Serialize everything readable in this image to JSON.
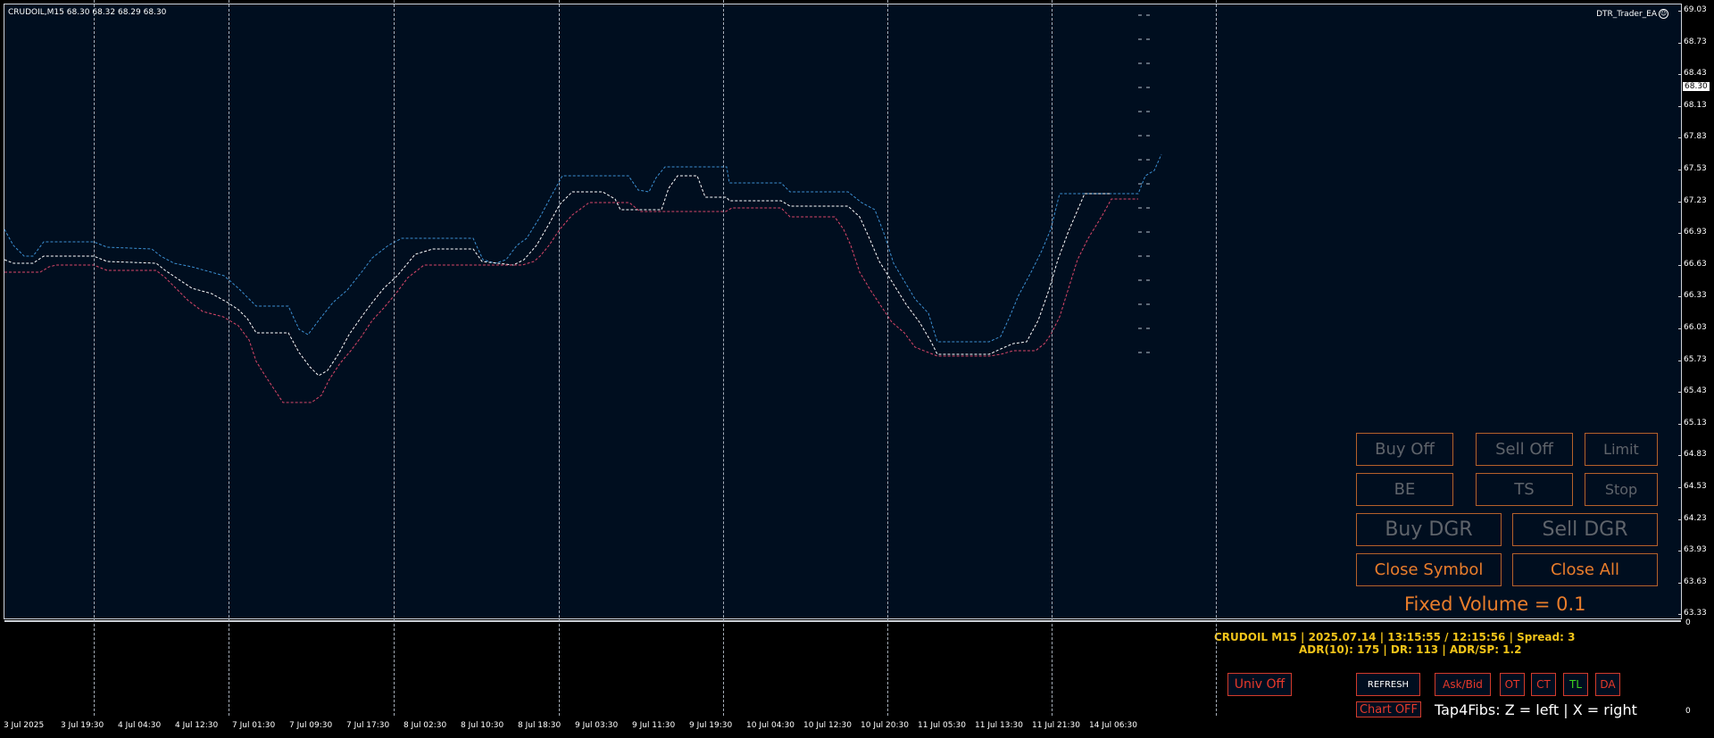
{
  "chart": {
    "symbol_info": "CRUDOIL,M15  68.30 68.32 68.29 68.30",
    "ea_name": "DTR_Trader_EA",
    "ea_icon": "smiley-icon",
    "current_price": "68.30",
    "colors": {
      "background": "#000e1f",
      "upper_band": "#3b8fd1",
      "middle_line": "#ffffff",
      "lower_band": "#d9476a",
      "accent": "#e97d2b",
      "info": "#f2c419"
    }
  },
  "y_axis": [
    "69.03",
    "68.73",
    "68.43",
    "68.13",
    "67.83",
    "67.53",
    "67.23",
    "66.93",
    "66.63",
    "66.33",
    "66.03",
    "65.73",
    "65.43",
    "65.13",
    "64.83",
    "64.53",
    "64.23",
    "63.93",
    "63.63",
    "63.33"
  ],
  "sub_axis": [
    "0",
    "0"
  ],
  "x_axis": [
    "3 Jul 2025",
    "3 Jul 19:30",
    "4 Jul 04:30",
    "4 Jul 12:30",
    "7 Jul 01:30",
    "7 Jul 09:30",
    "7 Jul 17:30",
    "8 Jul 02:30",
    "8 Jul 10:30",
    "8 Jul 18:30",
    "9 Jul 03:30",
    "9 Jul 11:30",
    "9 Jul 19:30",
    "10 Jul 04:30",
    "10 Jul 12:30",
    "10 Jul 20:30",
    "11 Jul 05:30",
    "11 Jul 13:30",
    "11 Jul 21:30",
    "14 Jul 06:30"
  ],
  "panel": {
    "buy_off": "Buy Off",
    "sell_off": "Sell Off",
    "limit": "Limit",
    "be": "BE",
    "ts": "TS",
    "stop": "Stop",
    "buy_dgr": "Buy DGR",
    "sell_dgr": "Sell DGR",
    "close_symbol": "Close Symbol",
    "close_all": "Close All",
    "fixed_volume": "Fixed Volume = 0.1"
  },
  "info": {
    "line1": "CRUDOIL M15 | 2025.07.14 | 13:15:55 / 12:15:56 | Spread: 3",
    "line2": "ADR(10): 175 | DR: 113 | ADR/SP: 1.2"
  },
  "sub_buttons": {
    "univ_off": "Univ Off",
    "refresh": "REFRESH",
    "ask_bid": "Ask/Bid",
    "ot": "OT",
    "ct": "CT",
    "tl": "TL",
    "da": "DA",
    "chart_off": "Chart OFF"
  },
  "tap4fibs": "Tap4Fibs: Z = left | X = right"
}
